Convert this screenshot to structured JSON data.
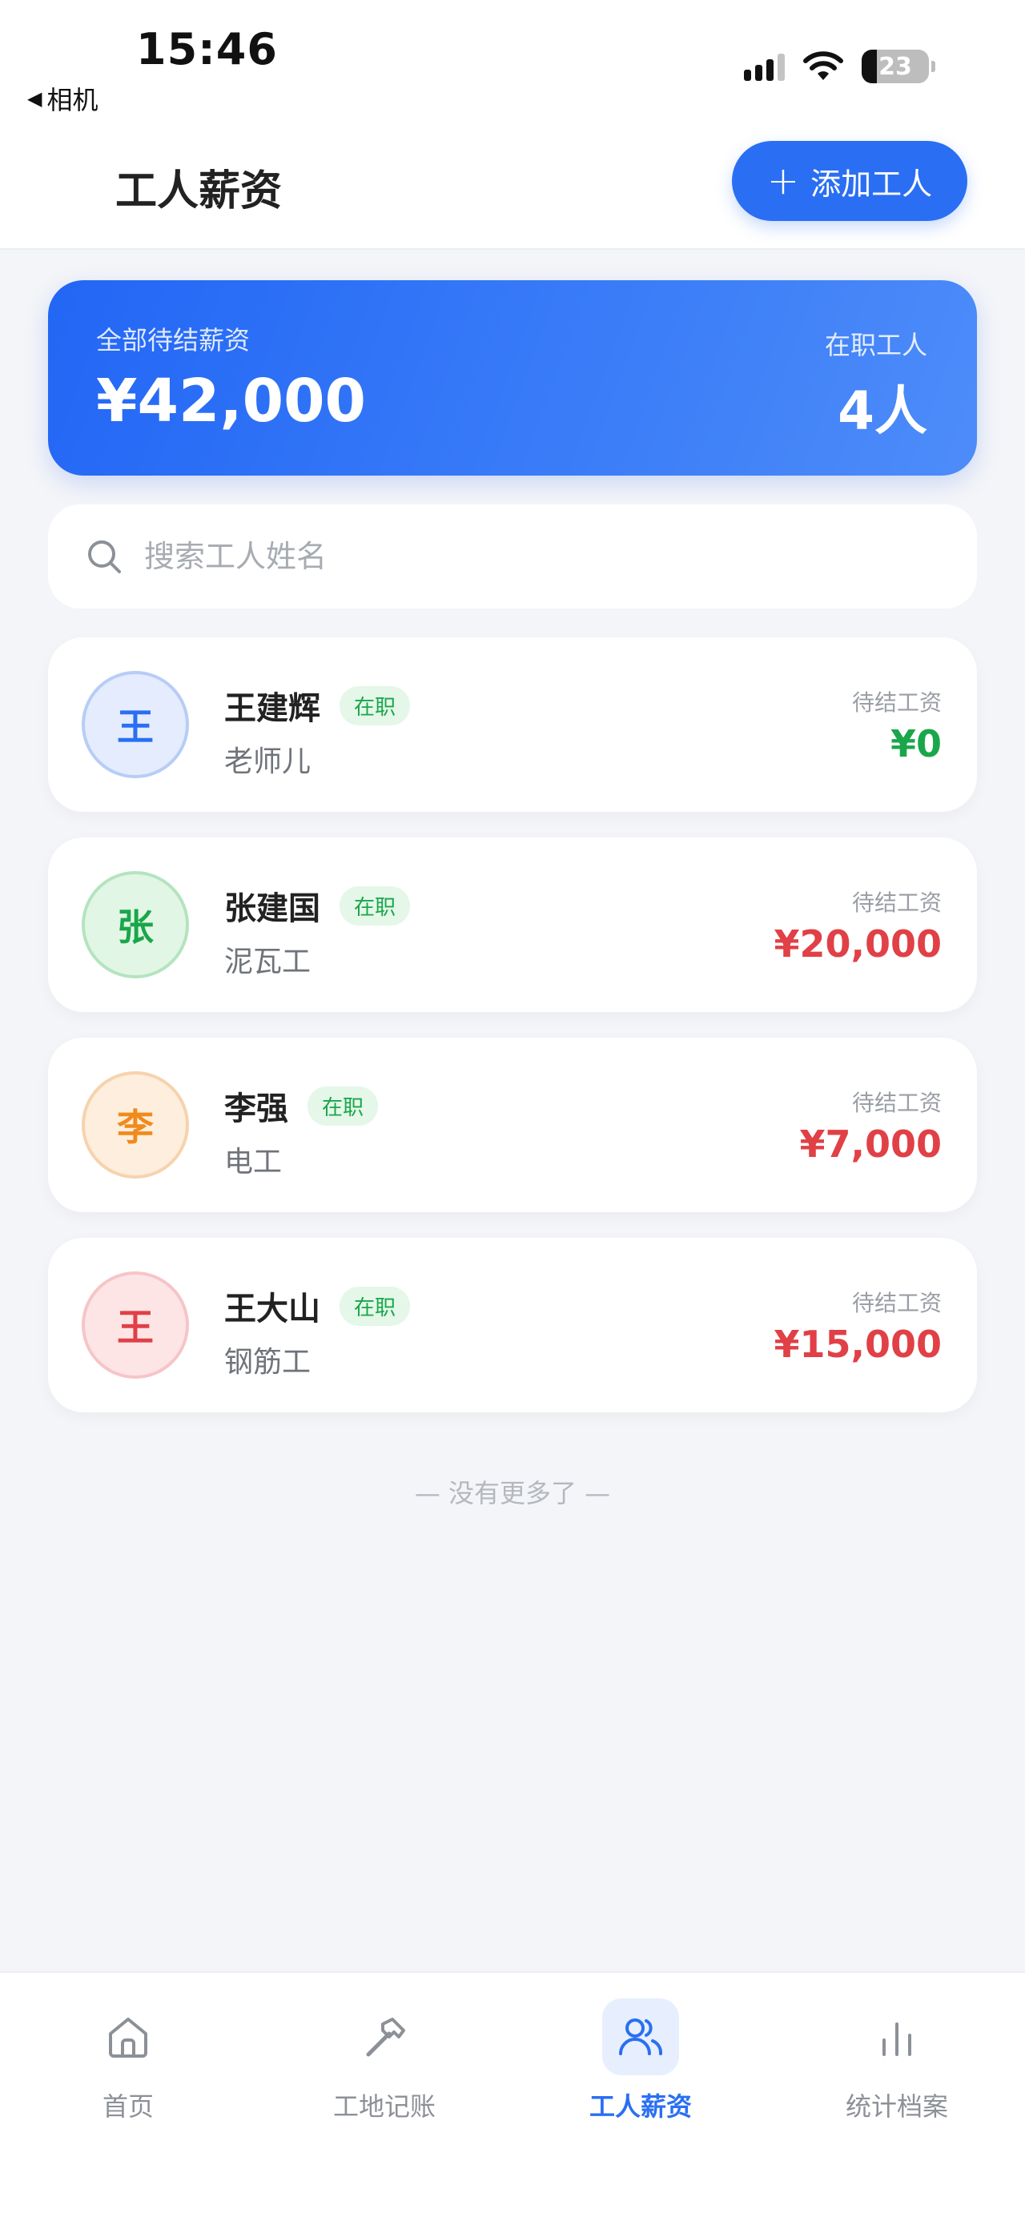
{
  "status_bar": {
    "time": "15:46",
    "back_app": "相机",
    "battery": "23",
    "battery_percent": 23
  },
  "header": {
    "title": "工人薪资",
    "add_button_label": "添加工人"
  },
  "summary": {
    "pending_label": "全部待结薪资",
    "pending_total": "¥42,000",
    "active_label": "在职工人",
    "active_count": "4人"
  },
  "search": {
    "placeholder": "搜索工人姓名",
    "value": ""
  },
  "workers": [
    {
      "avatar": "王",
      "name": "王建辉",
      "status": "在职",
      "role": "老师儿",
      "wage_label": "待结工资",
      "wage": "¥0",
      "avatar_bg": "#e4ecfd",
      "avatar_border": "#b7cdf6",
      "avatar_color": "#2a6ff3",
      "wage_color": "#1aa64a"
    },
    {
      "avatar": "张",
      "name": "张建国",
      "status": "在职",
      "role": "泥瓦工",
      "wage_label": "待结工资",
      "wage": "¥20,000",
      "avatar_bg": "#e2f6e6",
      "avatar_border": "#b4e4bf",
      "avatar_color": "#1aa64a",
      "wage_color": "#e04046"
    },
    {
      "avatar": "李",
      "name": "李强",
      "status": "在职",
      "role": "电工",
      "wage_label": "待结工资",
      "wage": "¥7,000",
      "avatar_bg": "#fdeedd",
      "avatar_border": "#f6d3ad",
      "avatar_color": "#f08a1c",
      "wage_color": "#e04046"
    },
    {
      "avatar": "王",
      "name": "王大山",
      "status": "在职",
      "role": "钢筋工",
      "wage_label": "待结工资",
      "wage": "¥15,000",
      "avatar_bg": "#fde5e6",
      "avatar_border": "#f6c5c7",
      "avatar_color": "#e04046",
      "wage_color": "#e04046"
    }
  ],
  "list_footer": "— 没有更多了 —",
  "tabs": [
    {
      "label": "首页",
      "icon": "home-icon",
      "active": false
    },
    {
      "label": "工地记账",
      "icon": "hammer-icon",
      "active": false
    },
    {
      "label": "工人薪资",
      "icon": "users-icon",
      "active": true
    },
    {
      "label": "统计档案",
      "icon": "bar-chart-icon",
      "active": false
    }
  ],
  "colors": {
    "accent": "#2a6ff3",
    "positive": "#1aa64a",
    "negative": "#e04046"
  }
}
